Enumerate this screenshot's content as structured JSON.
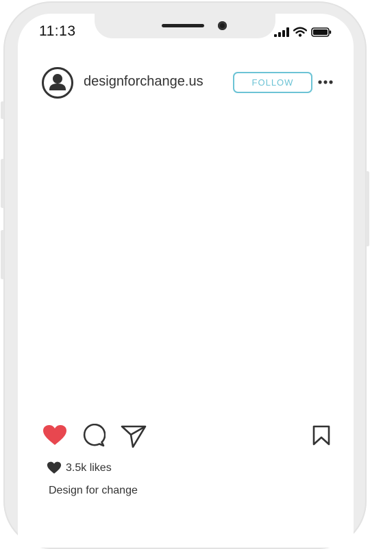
{
  "status_bar": {
    "time": "11:13",
    "icons": [
      "signal-icon",
      "wifi-icon",
      "battery-icon"
    ]
  },
  "post": {
    "username": "designforchange.us",
    "follow_label": "FOLLOW",
    "likes": "3.5k likes",
    "caption": "Design for change",
    "liked": true
  },
  "colors": {
    "accent": "#6cc3d5",
    "like_red": "#e8474f",
    "frame": "#ececec",
    "text": "#333333"
  },
  "action_icons": [
    "heart-icon",
    "comment-icon",
    "share-icon",
    "bookmark-icon"
  ]
}
